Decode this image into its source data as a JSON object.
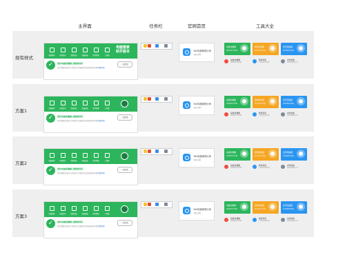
{
  "columns": {
    "main": "主界面",
    "taskbar": "任务栏",
    "homepage": "官网首页",
    "tools": "工具大全"
  },
  "rows": [
    {
      "label": "现有样式"
    },
    {
      "label": "方案1"
    },
    {
      "label": "方案2"
    },
    {
      "label": "方案3"
    }
  ],
  "mainwin": {
    "brand_lines": [
      "电脑管家",
      "助手版本"
    ],
    "status_title": "您的电脑很健康,请继续保持",
    "status_desc": "您的电脑状态良好,已经进行过全面检查,没有发现任何问题",
    "status_link": "重新体检",
    "button": "一键优化",
    "nav": [
      "电脑体检",
      "病毒查杀",
      "清理垃圾",
      "电脑加速",
      "软件管理",
      "工具箱"
    ]
  },
  "homepage": {
    "title": "360电脑管理大师",
    "sub1": "下载",
    "sub2": "官网"
  },
  "tools": {
    "cards": [
      {
        "title": "系统急救箱",
        "sub": "修复系统异常问题"
      },
      {
        "title": "游戏优化器",
        "sub": "提升游戏运行速度"
      },
      {
        "title": "宽带测速器",
        "sub": "测试网络带宽速度"
      }
    ],
    "items": [
      {
        "title": "系统急救箱",
        "sub": "修复系统异常问题"
      },
      {
        "title": "软件管家",
        "sub": "下载安装常用软件"
      },
      {
        "title": "文件恢复",
        "sub": "恢复误删除的文件"
      }
    ]
  },
  "colors": {
    "green": "#2cb55c",
    "orange": "#f5a623",
    "blue": "#2a95f1",
    "red": "#ef4b3f",
    "tray_yellow": "#f5c231",
    "tray_red": "#e14b3b",
    "tray_blue": "#3a8ee6",
    "tray_gray": "#7d8a99"
  }
}
